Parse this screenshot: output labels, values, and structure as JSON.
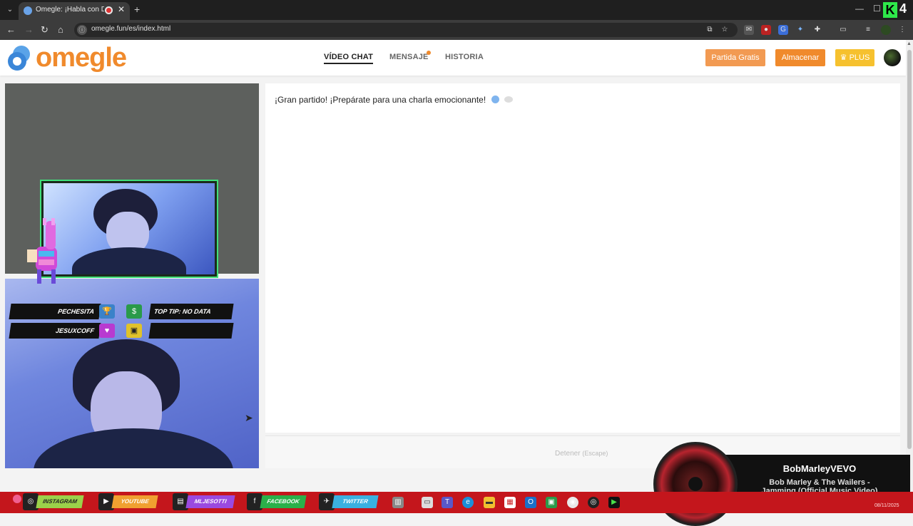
{
  "browser": {
    "tab_title": "Omegle: ¡Habla con Descon",
    "url": "omegle.fun/es/index.html",
    "corner_badge": "4",
    "corner_logo": "K"
  },
  "header": {
    "logo_text": "omegle",
    "nav": [
      "VÍDEO CHAT",
      "MENSAJE",
      "HISTORIA"
    ],
    "btn_free": "Partida Gratis",
    "btn_store": "Almacenar",
    "btn_plus": "PLUS",
    "plus_icon": "crown-icon"
  },
  "overlay": {
    "row1_name": "PECHESITA",
    "row1_tip": "TOP TIP: NO DATA",
    "row2_name": "JESUXCOFF"
  },
  "chat": {
    "message": "¡Gran partido! ¡Prepárate para una charla emocionante!",
    "stop_label": "Detener",
    "stop_hint": "(Escape)"
  },
  "music": {
    "channel": "BobMarleyVEVO",
    "title": "Bob Marley & The Wailers - Jamming (Official Music Video)"
  },
  "stream_bar": {
    "socials": [
      "INSTAGRAM",
      "YOUTUBE",
      "MLJESOTTI",
      "FACEBOOK",
      "TWITTER"
    ],
    "date": "08/11/2025"
  },
  "colors": {
    "brand": "#f08a2c",
    "store": "#f08a2c",
    "plus": "#f6c12e",
    "stream_bar": "#c4161c"
  }
}
